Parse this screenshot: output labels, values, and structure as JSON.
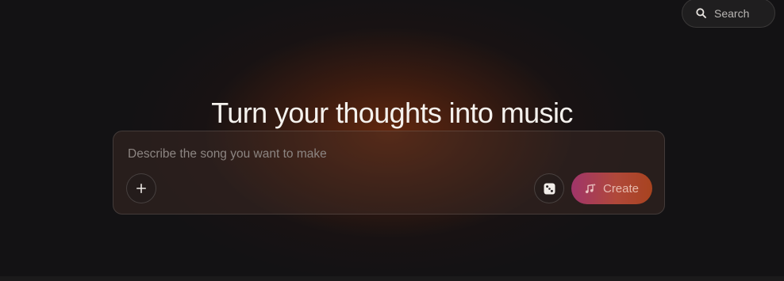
{
  "header": {
    "search_label": "Search"
  },
  "hero": {
    "title": "Turn your thoughts into music"
  },
  "composer": {
    "placeholder": "Describe the song you want to make",
    "value": "",
    "create_label": "Create"
  },
  "icons": {
    "search": "search-icon",
    "add": "plus-icon",
    "random": "dice-icon",
    "create": "music-note-sparkle-icon"
  },
  "colors": {
    "background": "#131214",
    "glow": "#78300c",
    "create_gradient_start": "#a0356a",
    "create_gradient_end": "#a8431f",
    "title": "#f5f2ee"
  }
}
